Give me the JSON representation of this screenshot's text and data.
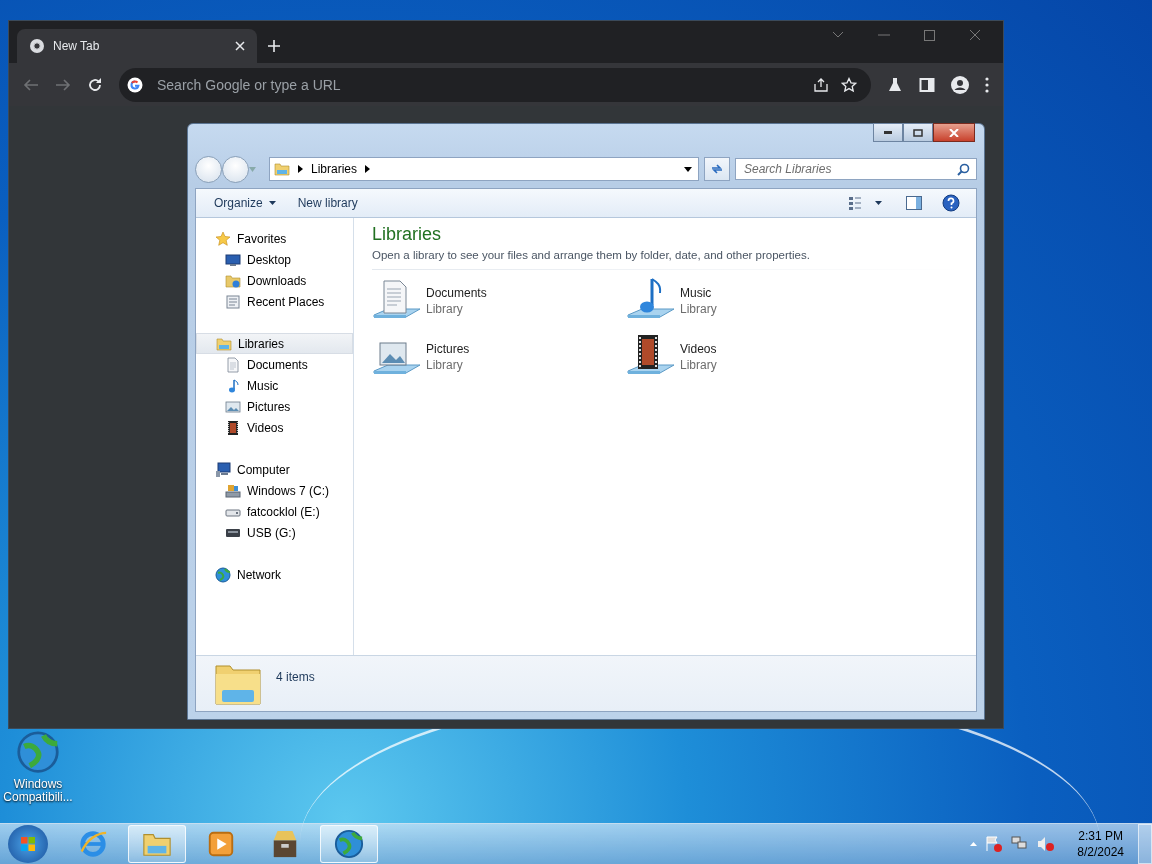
{
  "desktop_icons": [
    {
      "label": "Windows Compatibili..."
    }
  ],
  "browser": {
    "tabs": [
      {
        "title": "New Tab",
        "selected": true
      }
    ],
    "address_bar": {
      "placeholder": "Search Google or type a URL"
    }
  },
  "explorer": {
    "breadcrumb": [
      "Libraries"
    ],
    "search": {
      "placeholder": "Search Libraries"
    },
    "toolbar": [
      {
        "label": "Organize",
        "dropdown": true
      },
      {
        "label": "New library",
        "dropdown": false
      }
    ],
    "navigation": [
      {
        "label": "Favorites",
        "kind": "star",
        "selected": false,
        "children": [
          {
            "label": "Desktop",
            "kind": "desktop",
            "selected": false
          },
          {
            "label": "Downloads",
            "kind": "downloads",
            "selected": false
          },
          {
            "label": "Recent Places",
            "kind": "recent",
            "selected": false
          }
        ]
      },
      {
        "label": "Libraries",
        "kind": "library",
        "selected": true,
        "children": [
          {
            "label": "Documents",
            "kind": "documents",
            "selected": false
          },
          {
            "label": "Music",
            "kind": "music",
            "selected": false
          },
          {
            "label": "Pictures",
            "kind": "pictures",
            "selected": false
          },
          {
            "label": "Videos",
            "kind": "videos",
            "selected": false
          }
        ]
      },
      {
        "label": "Computer",
        "kind": "computer",
        "selected": false,
        "children": [
          {
            "label": "Windows 7 (C:)",
            "kind": "system-drive",
            "selected": false
          },
          {
            "label": "fatcocklol (E:)",
            "kind": "drive",
            "selected": false
          },
          {
            "label": "USB (G:)",
            "kind": "usb",
            "selected": false
          }
        ]
      },
      {
        "label": "Network",
        "kind": "network",
        "selected": false
      }
    ],
    "heading": "Libraries",
    "description": "Open a library to see your files and arrange them by folder, date, and other properties.",
    "libraries": [
      {
        "name": "Documents",
        "type": "Library",
        "kind": "documents"
      },
      {
        "name": "Music",
        "type": "Library",
        "kind": "music"
      },
      {
        "name": "Pictures",
        "type": "Library",
        "kind": "pictures"
      },
      {
        "name": "Videos",
        "type": "Library",
        "kind": "videos"
      }
    ],
    "status": "4 items"
  },
  "taskbar": {
    "items": [
      {
        "kind": "ie",
        "active": false
      },
      {
        "kind": "folder",
        "active": true
      },
      {
        "kind": "media",
        "active": false
      },
      {
        "kind": "archive",
        "active": false
      },
      {
        "kind": "globe",
        "active": true
      }
    ],
    "time": "2:31 PM",
    "date": "8/2/2024"
  }
}
